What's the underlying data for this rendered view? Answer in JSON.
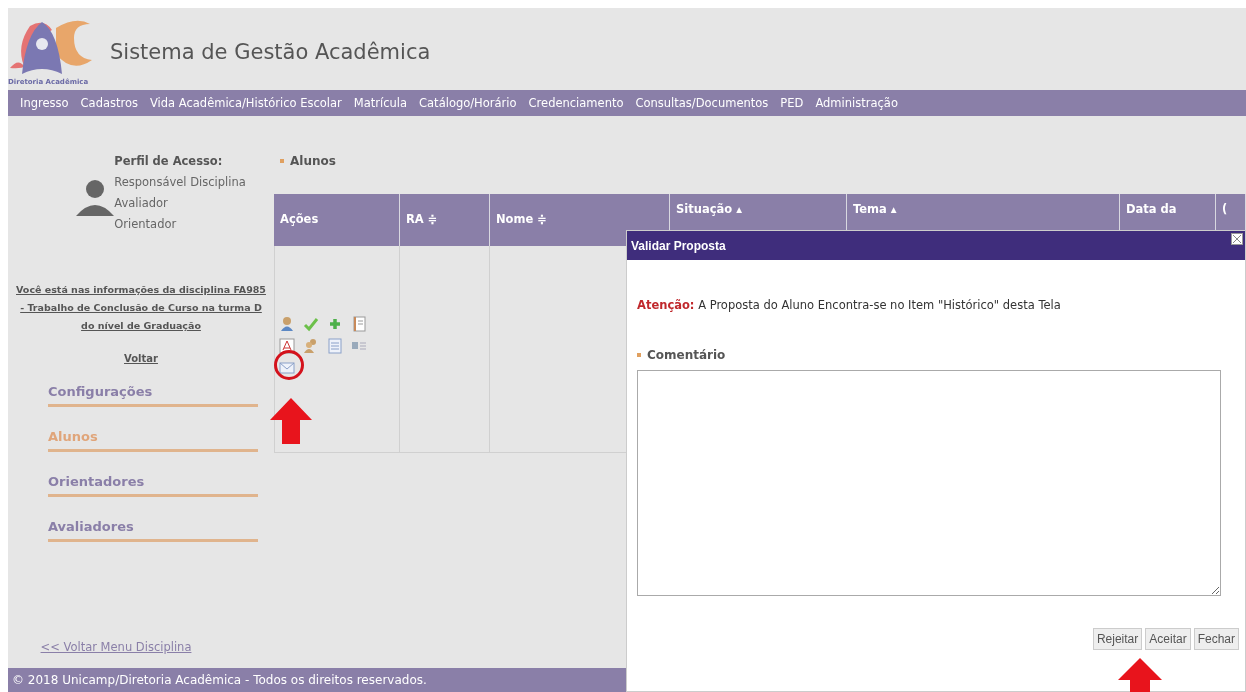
{
  "header": {
    "logo_caption": "Diretoria Acadêmica",
    "title": "Sistema de Gestão Acadêmica"
  },
  "nav": [
    "Ingresso",
    "Cadastros",
    "Vida Acadêmica/Histórico Escolar",
    "Matrícula",
    "Catálogo/Horário",
    "Credenciamento",
    "Consultas/Documentos",
    "PED",
    "Administração"
  ],
  "profile": {
    "heading": "Perfil de Acesso:",
    "roles": [
      "Responsável Disciplina",
      "Avaliador",
      "Orientador"
    ]
  },
  "discipline_link": "Você está nas informações da disciplina FA985 - Trabalho de Conclusão de Curso na turma D do nível de Graduação",
  "back_link": "Voltar",
  "sidebar": {
    "items": [
      {
        "label": "Configurações",
        "selected": false
      },
      {
        "label": "Alunos",
        "selected": true
      },
      {
        "label": "Orientadores",
        "selected": false
      },
      {
        "label": "Avaliadores",
        "selected": false
      }
    ]
  },
  "menu_back_link": "<< Voltar Menu Disciplina",
  "section_title": "Alunos",
  "table": {
    "columns": [
      "Ações",
      "RA ≑",
      "Nome ≑",
      "Situação ▴",
      "Tema ▴",
      "Data da",
      "("
    ],
    "action_icons": [
      {
        "kind": "person"
      },
      {
        "kind": "check"
      },
      {
        "kind": "plus"
      },
      {
        "kind": "notebook"
      },
      {
        "kind": "pdf"
      },
      {
        "kind": "people"
      },
      {
        "kind": "list"
      },
      {
        "kind": "card"
      },
      {
        "kind": "mail"
      }
    ]
  },
  "dialog": {
    "title": "Validar Proposta",
    "warning_label": "Atenção:",
    "warning_text": "A Proposta do Aluno Encontra-se no Item \"Histórico\" desta Tela",
    "comment_label": "Comentário",
    "buttons": [
      "Rejeitar",
      "Aceitar",
      "Fechar"
    ]
  },
  "footer": {
    "copyright": "© 2018 Unicamp/Diretoria Acadêmica - Todos os direitos reservados."
  }
}
